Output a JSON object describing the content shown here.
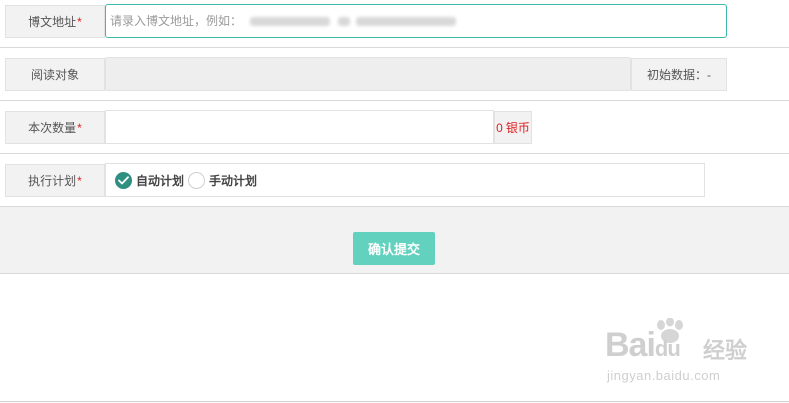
{
  "form": {
    "url_row": {
      "label": "博文地址",
      "required_mark": "*",
      "placeholder": "请录入博文地址，例如："
    },
    "target_row": {
      "label": "阅读对象",
      "initial_data_label": "初始数据：-"
    },
    "quantity_row": {
      "label": "本次数量",
      "required_mark": "*",
      "coin_value": "0",
      "coin_unit": "银币"
    },
    "plan_row": {
      "label": "执行计划",
      "required_mark": "*",
      "options": [
        {
          "label": "自动计划",
          "selected": true
        },
        {
          "label": "手动计划",
          "selected": false
        }
      ]
    }
  },
  "actions": {
    "submit_label": "确认提交"
  },
  "watermark": {
    "brand": "Bai",
    "brand_tail": "du",
    "brand_cn": "经验",
    "url": "jingyan.baidu.com"
  },
  "colors": {
    "accent": "#62d2bf",
    "focus_border": "#3fb8aa",
    "required": "#e02020",
    "radio_checked": "#2f8f80"
  }
}
